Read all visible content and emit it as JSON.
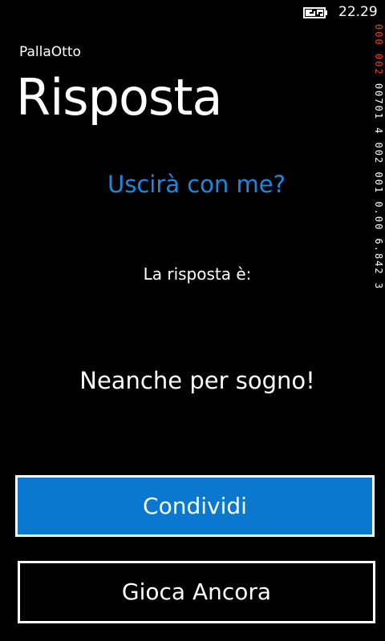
{
  "status_bar": {
    "time": "22.29",
    "battery_icon": "battery-charging-icon"
  },
  "app": {
    "name": "PallaOtto",
    "page_title": "Risposta"
  },
  "main": {
    "question": "Uscirà con me?",
    "answer_label": "La risposta è:",
    "answer": "Neanche per sogno!"
  },
  "buttons": {
    "share_label": "Condividi",
    "play_again_label": "Gioca Ancora"
  },
  "debug_counters": {
    "red_text": "000 002",
    "white_text": "00701 4 002 001 0.00 6.842 3"
  },
  "colors": {
    "background": "#000000",
    "accent": "#1a8ae0",
    "button_fill": "#0b78d0",
    "counter_red": "#e8441c"
  }
}
